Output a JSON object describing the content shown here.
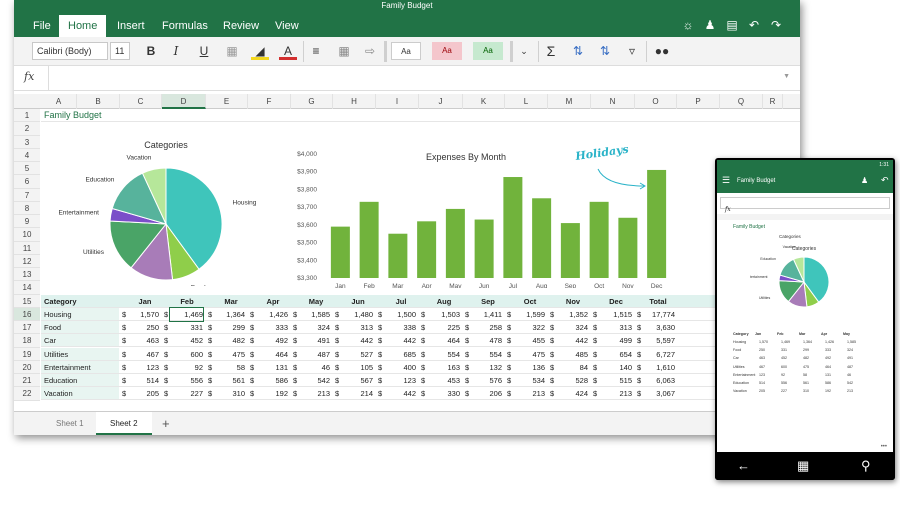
{
  "app": {
    "title": "Family Budget",
    "menu_tabs": [
      "File",
      "Home",
      "Insert",
      "Formulas",
      "Review",
      "View"
    ],
    "active_tab": "Home"
  },
  "ribbon": {
    "font_name": "Calibri (Body)",
    "font_size": "11",
    "style_normal": "Aa",
    "style_bad": "Aa",
    "style_good": "Aa"
  },
  "formula_bar": {
    "fx": "fx",
    "value": ""
  },
  "columns": [
    "A",
    "B",
    "C",
    "D",
    "E",
    "F",
    "G",
    "H",
    "I",
    "J",
    "K",
    "L",
    "M",
    "N",
    "O",
    "P",
    "Q",
    "R"
  ],
  "rows": [
    "1",
    "2",
    "3",
    "4",
    "5",
    "6",
    "7",
    "8",
    "9",
    "10",
    "11",
    "12",
    "13",
    "14",
    "15",
    "16",
    "17",
    "18",
    "19",
    "20",
    "21",
    "22"
  ],
  "sheet": {
    "title": "Family Budget",
    "headers": [
      "Category",
      "Jan",
      "Feb",
      "Mar",
      "Apr",
      "May",
      "Jun",
      "Jul",
      "Aug",
      "Sep",
      "Oct",
      "Nov",
      "Dec",
      "Total"
    ],
    "currency": "$",
    "data": [
      {
        "category": "Housing",
        "values": [
          "1,570",
          "1,469",
          "1,364",
          "1,426",
          "1,585",
          "1,480",
          "1,500",
          "1,503",
          "1,411",
          "1,599",
          "1,352",
          "1,515"
        ],
        "total": "17,774"
      },
      {
        "category": "Food",
        "values": [
          "250",
          "331",
          "299",
          "333",
          "324",
          "313",
          "338",
          "225",
          "258",
          "322",
          "324",
          "313"
        ],
        "total": "3,630"
      },
      {
        "category": "Car",
        "values": [
          "463",
          "452",
          "482",
          "492",
          "491",
          "442",
          "442",
          "464",
          "478",
          "455",
          "442",
          "499"
        ],
        "total": "5,597"
      },
      {
        "category": "Utilities",
        "values": [
          "467",
          "600",
          "475",
          "464",
          "487",
          "527",
          "685",
          "554",
          "554",
          "475",
          "485",
          "654"
        ],
        "total": "6,727"
      },
      {
        "category": "Entertainment",
        "values": [
          "123",
          "92",
          "58",
          "131",
          "46",
          "105",
          "400",
          "163",
          "132",
          "136",
          "84",
          "140"
        ],
        "total": "1,610"
      },
      {
        "category": "Education",
        "values": [
          "514",
          "556",
          "561",
          "586",
          "542",
          "567",
          "123",
          "453",
          "576",
          "534",
          "528",
          "515"
        ],
        "total": "6,063"
      },
      {
        "category": "Vacation",
        "values": [
          "205",
          "227",
          "310",
          "192",
          "213",
          "214",
          "442",
          "330",
          "206",
          "213",
          "424",
          "213"
        ],
        "total": "3,067"
      }
    ]
  },
  "pie_chart": {
    "title": "Categories",
    "slices": [
      {
        "label": "Housing",
        "value": 17774,
        "color": "#3fc5bb"
      },
      {
        "label": "Food",
        "value": 3630,
        "color": "#8fce4a"
      },
      {
        "label": "Car",
        "value": 5597,
        "color": "#a87cb8"
      },
      {
        "label": "Utilities",
        "value": 6727,
        "color": "#4aa467"
      },
      {
        "label": "Entertainment",
        "value": 1610,
        "color": "#7b4fc9"
      },
      {
        "label": "Education",
        "value": 6063,
        "color": "#57b39c"
      },
      {
        "label": "Vacation",
        "value": 3067,
        "color": "#b6e79a"
      }
    ]
  },
  "chart_data": {
    "type": "bar",
    "title": "Expenses By Month",
    "categories": [
      "Jan",
      "Feb",
      "Mar",
      "Apr",
      "May",
      "Jun",
      "Jul",
      "Aug",
      "Sep",
      "Oct",
      "Nov",
      "Dec"
    ],
    "values": [
      3590,
      3730,
      3550,
      3620,
      3690,
      3630,
      3870,
      3750,
      3610,
      3730,
      3640,
      3910
    ],
    "ylim": [
      3300,
      4000
    ],
    "yticks": [
      "$4,000",
      "$3,900",
      "$3,800",
      "$3,700",
      "$3,600",
      "$3,500",
      "$3,400",
      "$3,300"
    ],
    "annotation": "Holidays",
    "color": "#71b33c"
  },
  "sheet_tabs": [
    "Sheet 1",
    "Sheet 2"
  ],
  "active_sheet": "Sheet 2",
  "phone": {
    "time": "1:31",
    "title": "Family Budget"
  },
  "colors": {
    "brand": "#217346",
    "accent": "#3fc5bb"
  }
}
